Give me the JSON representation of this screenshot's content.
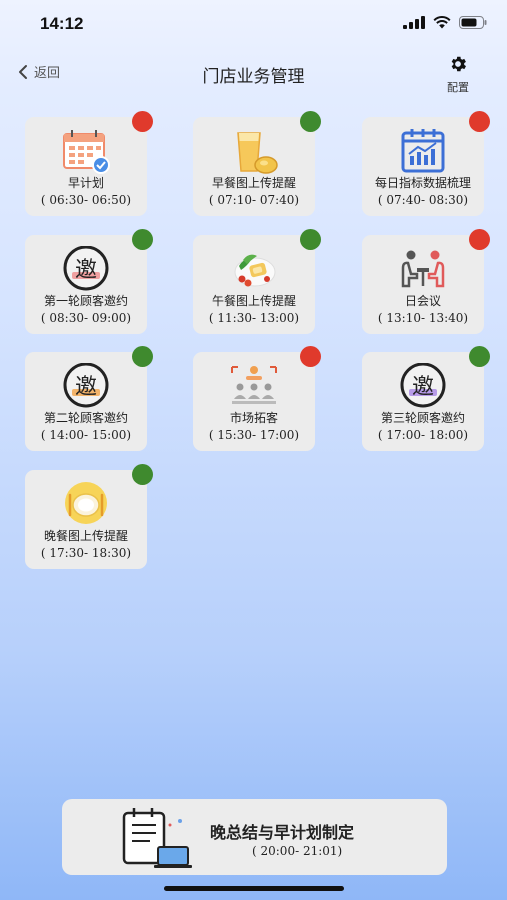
{
  "status_bar": {
    "time": "14:12"
  },
  "nav": {
    "back_label": "返回",
    "title": "门店业务管理",
    "config_label": "配置"
  },
  "colors": {
    "red_status": "#e03a2c",
    "green_status": "#3f8a2e",
    "card_bg": "#ececec"
  },
  "tasks": [
    {
      "name": "早计划",
      "time": "( 06:30- 06:50)",
      "status": "red",
      "icon": "calendar-icon"
    },
    {
      "name": "早餐图上传提醒",
      "time": "( 07:10- 07:40)",
      "status": "green",
      "icon": "breakfast-icon"
    },
    {
      "name": "每日指标数据梳理",
      "time": "( 07:40- 08:30)",
      "status": "red",
      "icon": "chart-calendar-icon"
    },
    {
      "name": "第一轮顾客邀约",
      "time": "( 08:30- 09:00)",
      "status": "green",
      "icon": "invite-icon"
    },
    {
      "name": "午餐图上传提醒",
      "time": "( 11:30- 13:00)",
      "status": "green",
      "icon": "lunch-icon"
    },
    {
      "name": "日会议",
      "time": "( 13:10- 13:40)",
      "status": "red",
      "icon": "meeting-icon"
    },
    {
      "name": "第二轮顾客邀约",
      "time": "( 14:00- 15:00)",
      "status": "green",
      "icon": "invite-icon"
    },
    {
      "name": "市场拓客",
      "time": "( 15:30- 17:00)",
      "status": "red",
      "icon": "market-icon"
    },
    {
      "name": "第三轮顾客邀约",
      "time": "( 17:00- 18:00)",
      "status": "green",
      "icon": "invite-icon"
    },
    {
      "name": "晚餐图上传提醒",
      "time": "( 17:30- 18:30)",
      "status": "green",
      "icon": "dinner-plate-icon"
    }
  ],
  "invite_glyph": "邀",
  "summary": {
    "title": "晚总结与早计划制定",
    "time": "( 20:00- 21:01)",
    "icon": "planning-desk-icon"
  }
}
